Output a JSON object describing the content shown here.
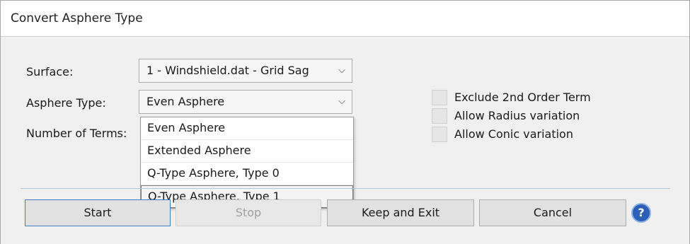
{
  "window": {
    "title": "Convert Asphere Type"
  },
  "form": {
    "surface_label": "Surface:",
    "surface_value": "1 - Windshield.dat - Grid Sag",
    "asphere_type_label": "Asphere Type:",
    "asphere_type_value": "Even Asphere",
    "terms_label": "Number of Terms:"
  },
  "dropdown": {
    "options": [
      "Even Asphere",
      "Extended Asphere",
      "Q-Type Asphere, Type 0",
      "Q-Type Asphere, Type 1"
    ]
  },
  "checkboxes": [
    {
      "label": "Exclude 2nd Order Term",
      "checked": false
    },
    {
      "label": "Allow Radius variation",
      "checked": false
    },
    {
      "label": "Allow Conic variation",
      "checked": false
    }
  ],
  "buttons": {
    "start": "Start",
    "stop": "Stop",
    "keep_exit": "Keep and Exit",
    "cancel": "Cancel",
    "help": "?"
  },
  "icons": {
    "dropdown_arrow": "chevron-down-icon",
    "help": "help-icon"
  },
  "colors": {
    "accent": "#3f7fc9",
    "help_blue": "#2b5fb8"
  }
}
